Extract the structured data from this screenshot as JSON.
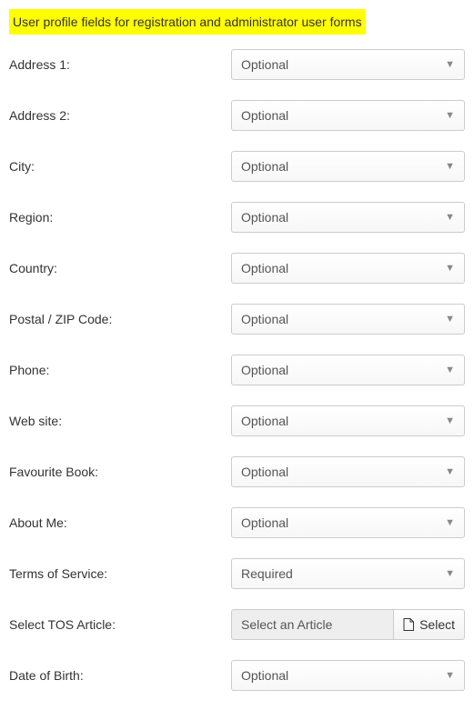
{
  "heading": "User profile fields for registration and administrator user forms",
  "option_optional": "Optional",
  "option_required": "Required",
  "fields": {
    "address1": {
      "label": "Address 1:",
      "value": "Optional"
    },
    "address2": {
      "label": "Address 2:",
      "value": "Optional"
    },
    "city": {
      "label": "City:",
      "value": "Optional"
    },
    "region": {
      "label": "Region:",
      "value": "Optional"
    },
    "country": {
      "label": "Country:",
      "value": "Optional"
    },
    "postal": {
      "label": "Postal / ZIP Code:",
      "value": "Optional"
    },
    "phone": {
      "label": "Phone:",
      "value": "Optional"
    },
    "website": {
      "label": "Web site:",
      "value": "Optional"
    },
    "favbook": {
      "label": "Favourite Book:",
      "value": "Optional"
    },
    "aboutme": {
      "label": "About Me:",
      "value": "Optional"
    },
    "tos": {
      "label": "Terms of Service:",
      "value": "Required"
    },
    "tos_article": {
      "label": "Select TOS Article:",
      "placeholder": "Select an Article",
      "button": "Select"
    },
    "dob": {
      "label": "Date of Birth:",
      "value": "Optional"
    }
  }
}
